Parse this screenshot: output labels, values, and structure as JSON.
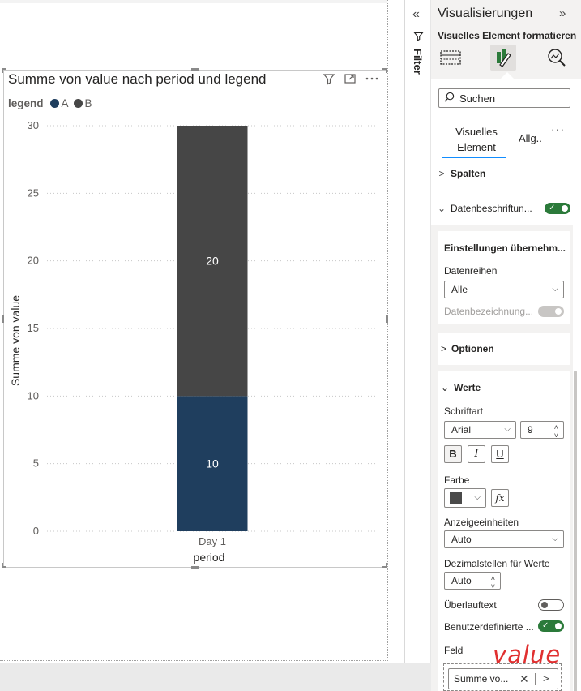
{
  "chart": {
    "title": "Summe von value nach period und legend",
    "legend_title": "legend",
    "legend_items": [
      {
        "name": "A",
        "color": "#1f3e5e"
      },
      {
        "name": "B",
        "color": "#464646"
      }
    ]
  },
  "chart_data": {
    "type": "bar",
    "stacked": true,
    "title": "Summe von value nach period und legend",
    "xlabel": "period",
    "ylabel": "Summe von value",
    "categories": [
      "Day 1"
    ],
    "series": [
      {
        "name": "A",
        "values": [
          10
        ],
        "color": "#1f3e5e"
      },
      {
        "name": "B",
        "values": [
          20
        ],
        "color": "#464646"
      }
    ],
    "ylim": [
      0,
      30
    ],
    "yticks": [
      "0",
      "5",
      "10",
      "15",
      "20",
      "25",
      "30"
    ],
    "data_labels": [
      "10",
      "20"
    ],
    "grid": true,
    "legend_position": "top-left"
  },
  "filter": {
    "label": "Filter",
    "collapse_glyph": "«"
  },
  "pane": {
    "title": "Visualisierungen",
    "expand_glyph": "»",
    "subtitle": "Visuelles Element formatieren",
    "search_placeholder": "Suchen",
    "tabs": {
      "visual_line1": "Visuelles",
      "visual_line2": "Element",
      "general": "Allg..",
      "more": "···"
    },
    "sections": {
      "spalten": "Spalten",
      "datenbeschriftungen": "Datenbeschriftun...",
      "einstellungen": "Einstellungen übernehm...",
      "datenreihen_label": "Datenreihen",
      "datenreihen_value": "Alle",
      "datenbezeichnung": "Datenbezeichnung...",
      "optionen": "Optionen",
      "werte": "Werte",
      "schriftart_label": "Schriftart",
      "font_value": "Arial",
      "font_size": "9",
      "bold": "B",
      "italic": "I",
      "underline": "U",
      "farbe_label": "Farbe",
      "farbe_color": "#4a4a4a",
      "fx": "fx",
      "anzeige_label": "Anzeigeeinheiten",
      "anzeige_value": "Auto",
      "dezimal_label": "Dezimalstellen für Werte",
      "dezimal_value": "Auto",
      "ueberlauf_label": "Überlauftext",
      "benutzer_label": "Benutzerdefinierte ...",
      "feld_label": "Feld",
      "field_value": "Summe vo..."
    }
  },
  "annotation": {
    "text": "value"
  }
}
